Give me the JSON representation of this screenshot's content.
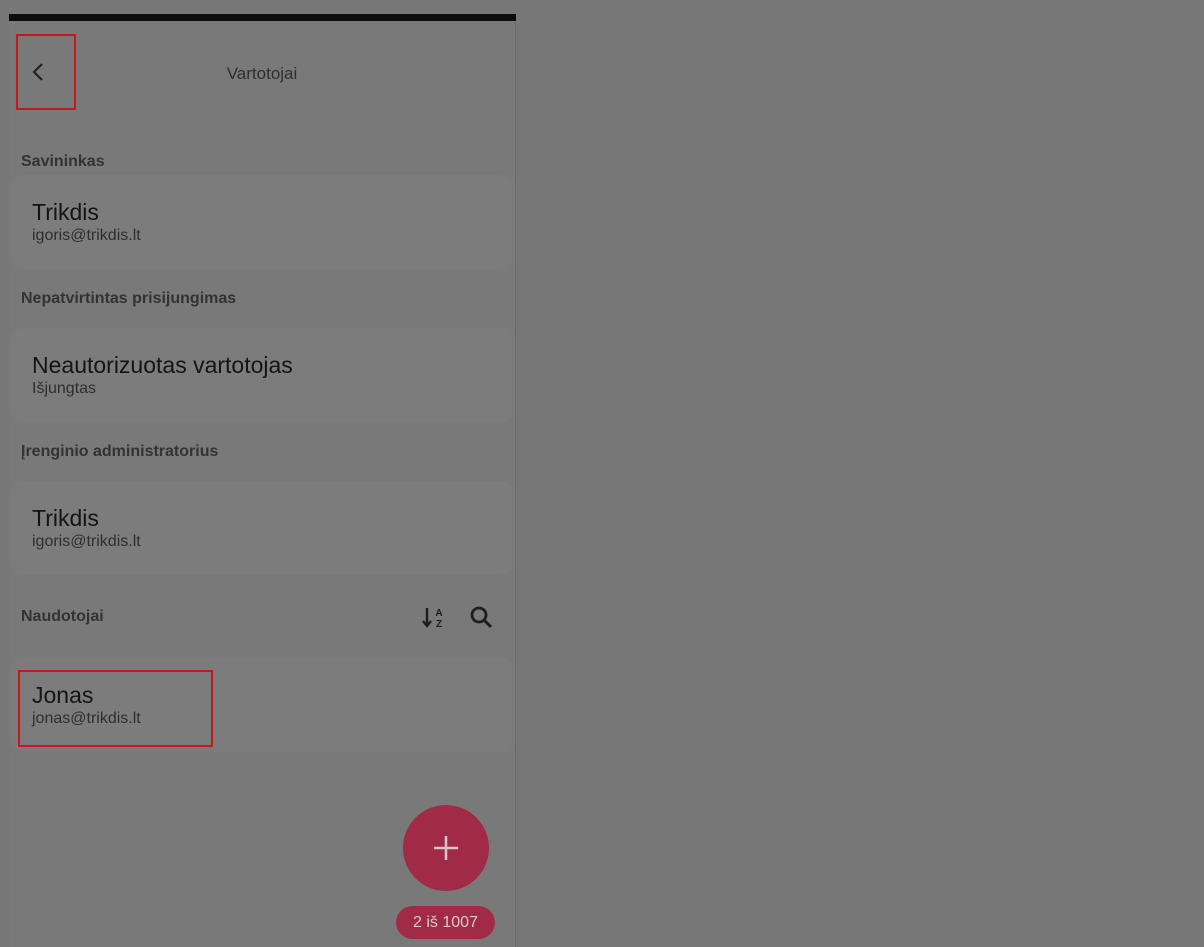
{
  "header": {
    "title": "Vartotojai",
    "back_icon": "chevron-left-icon"
  },
  "sections": {
    "owner": {
      "label": "Savininkas",
      "card": {
        "name": "Trikdis",
        "sub": "igoris@trikdis.lt"
      }
    },
    "unconfirmed": {
      "label": "Nepatvirtintas prisijungimas",
      "card": {
        "name": "Neautorizuotas vartotojas",
        "sub": "Išjungtas"
      }
    },
    "admin": {
      "label": "Įrenginio administratorius",
      "card": {
        "name": "Trikdis",
        "sub": "igoris@trikdis.lt"
      }
    },
    "users": {
      "label": "Naudotojai",
      "sort_icon": "sort-alpha-icon",
      "search_icon": "search-icon",
      "items": [
        {
          "name": "Jonas",
          "sub": "jonas@trikdis.lt"
        }
      ]
    }
  },
  "fab": {
    "icon": "plus-icon"
  },
  "count_badge": "2 iš 1007",
  "colors": {
    "accent": "#a12a47",
    "highlight": "#c41a1a",
    "overlay_bg": "#777777"
  }
}
